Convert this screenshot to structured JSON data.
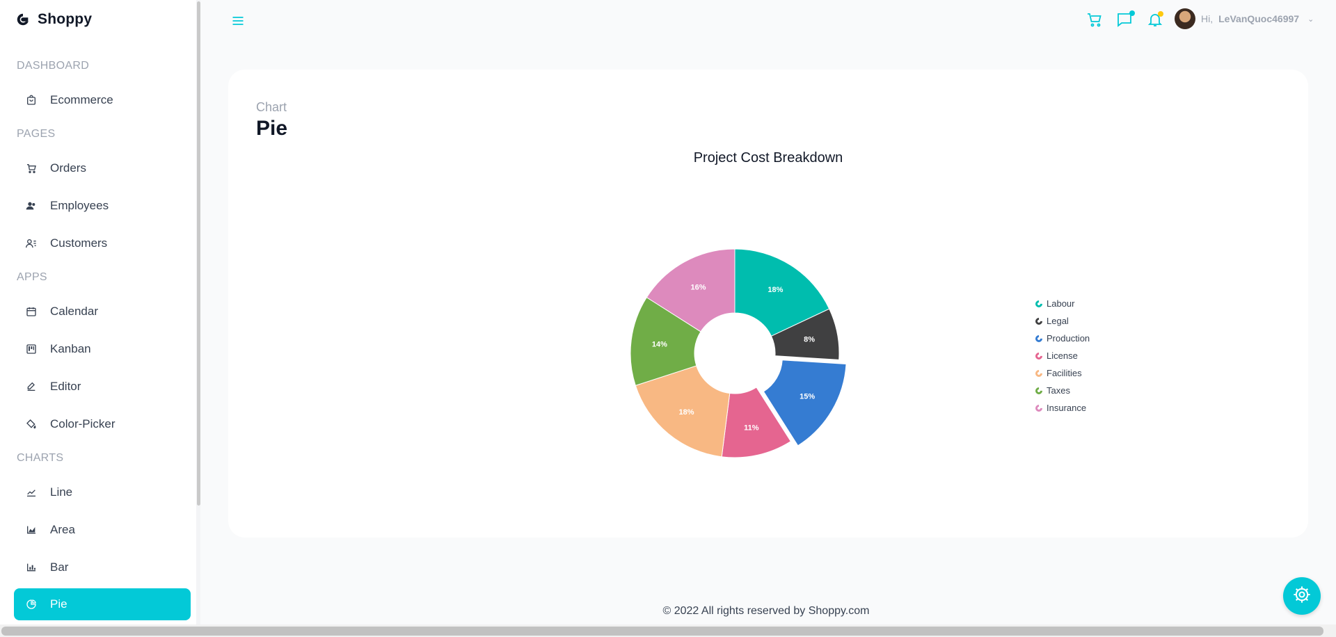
{
  "app": {
    "name": "Shoppy"
  },
  "sidebar": {
    "sections": [
      {
        "title": "Dashboard",
        "items": [
          {
            "label": "Ecommerce",
            "icon": "bag-icon"
          }
        ]
      },
      {
        "title": "Pages",
        "items": [
          {
            "label": "Orders",
            "icon": "cart-icon"
          },
          {
            "label": "Employees",
            "icon": "employees-icon"
          },
          {
            "label": "Customers",
            "icon": "customers-icon"
          }
        ]
      },
      {
        "title": "Apps",
        "items": [
          {
            "label": "Calendar",
            "icon": "calendar-icon"
          },
          {
            "label": "Kanban",
            "icon": "kanban-icon"
          },
          {
            "label": "Editor",
            "icon": "edit-icon"
          },
          {
            "label": "Color-Picker",
            "icon": "paint-bucket-icon"
          }
        ]
      },
      {
        "title": "Charts",
        "items": [
          {
            "label": "Line",
            "icon": "line-chart-icon"
          },
          {
            "label": "Area",
            "icon": "area-chart-icon"
          },
          {
            "label": "Bar",
            "icon": "bar-chart-icon"
          },
          {
            "label": "Pie",
            "icon": "pie-chart-icon",
            "active": true
          }
        ]
      }
    ]
  },
  "header": {
    "greeting": "Hi,",
    "username": "LeVanQuoc46997",
    "icons": [
      "menu-icon",
      "cart-icon",
      "chat-icon",
      "bell-icon"
    ],
    "badge_colors": {
      "chat": "#03c9d7",
      "bell": "#fec90f"
    }
  },
  "page": {
    "category": "Chart",
    "title": "Pie"
  },
  "chart_data": {
    "type": "pie",
    "title": "Project Cost Breakdown",
    "donut": true,
    "categories": [
      "Labour",
      "Legal",
      "Production",
      "License",
      "Facilities",
      "Taxes",
      "Insurance"
    ],
    "values": [
      18,
      8,
      15,
      11,
      18,
      14,
      16
    ],
    "labels": [
      "18%",
      "8%",
      "15%",
      "11%",
      "18%",
      "14%",
      "16%"
    ],
    "colors": [
      "#00bdae",
      "#404041",
      "#357cd2",
      "#e56590",
      "#f8b883",
      "#70ad47",
      "#dd8abd"
    ],
    "exploded": "Production",
    "legend": "right"
  },
  "footer": {
    "text": "© 2022 All rights reserved by Shoppy.com"
  },
  "accent": "#03c9d7"
}
